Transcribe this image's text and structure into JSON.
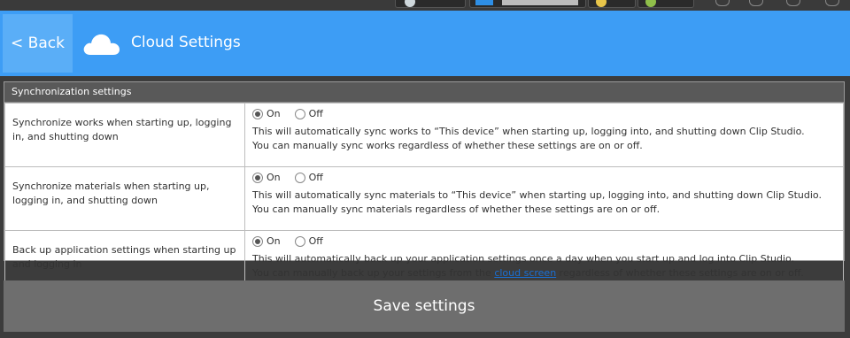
{
  "header": {
    "back_label": "< Back",
    "title": "Cloud Settings",
    "icon": "cloud-icon"
  },
  "panel": {
    "title": "Synchronization settings",
    "rows": [
      {
        "label": "Synchronize works when starting up, logging in, and shutting down",
        "options": [
          "On",
          "Off"
        ],
        "selected": "On",
        "desc1": "This will automatically sync works to “This device” when starting up, logging into, and shutting down Clip Studio.",
        "desc2": "You can manually sync works regardless of whether these settings are on or off."
      },
      {
        "label": "Synchronize materials when starting up, logging in, and shutting down",
        "options": [
          "On",
          "Off"
        ],
        "selected": "On",
        "desc1": "This will automatically sync materials to “This device” when starting up, logging into, and shutting down Clip Studio.",
        "desc2": "You can manually sync materials regardless of whether these settings are on or off."
      },
      {
        "label": "Back up application settings when starting up and logging in",
        "options": [
          "On",
          "Off"
        ],
        "selected": "On",
        "desc1": "This will automatically back up your application settings once a day when you start up and log into Clip Studio.",
        "desc2_pre": "You can manually back up your settings from the ",
        "desc2_link": "cloud screen",
        "desc2_post": " regardless of whether these settings are on or off."
      }
    ]
  },
  "save_label": "Save settings",
  "colors": {
    "header_bg": "#3d9df5",
    "back_bg": "#5aaef7",
    "panel_head_bg": "#595959",
    "save_bg": "#6e6e6e",
    "page_bg": "#3c3c3c"
  }
}
